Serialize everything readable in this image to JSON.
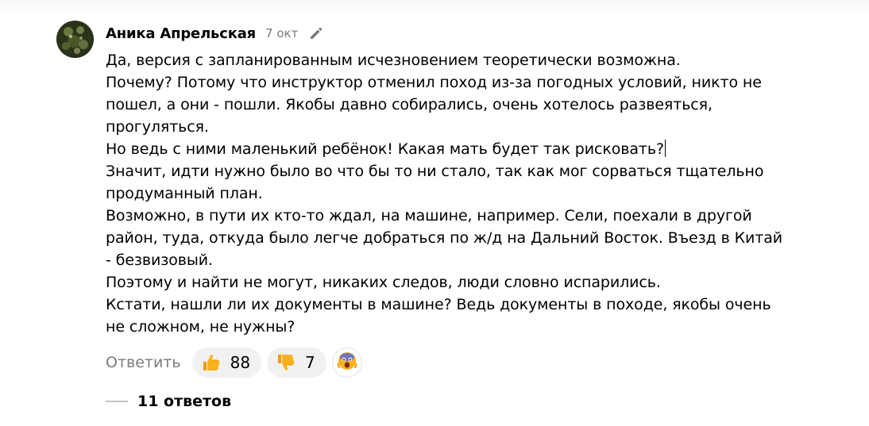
{
  "comment": {
    "author": "Аника Апрельская",
    "date": "7 окт",
    "edit_icon": "pencil-icon",
    "lines": [
      "Да, версия с запланированным исчезновением теоретически возможна.",
      "Почему? Потому что инструктор отменил поход из-за погодных условий, никто не",
      "пошел, а они - пошли. Якобы давно собирались, очень хотелось развеяться,",
      "прогуляться.",
      "Но ведь с ними маленький ребёнок! Какая мать будет так рисковать?",
      "Значит, идти нужно было во что бы то ни стало, так как мог сорваться тщательно",
      "продуманный план.",
      "Возможно, в пути их кто-то ждал, на машине, например. Сели, поехали в другой",
      "район, туда, откуда было легче добраться по ж/д на Дальний Восток. Въезд в Китай",
      "- безвизовый.",
      "Поэтому и найти не могут, никаких следов, люди словно испарились.",
      "Кстати, нашли ли их документы в машине? Ведь документы в походе, якобы очень",
      "не сложном, не нужны?"
    ]
  },
  "actions": {
    "reply_label": "Ответить",
    "like": {
      "icon": "thumbs-up-icon",
      "count": "88"
    },
    "dislike": {
      "icon": "thumbs-down-icon",
      "count": "7"
    },
    "shocked": {
      "icon": "shocked-face-icon"
    }
  },
  "replies": {
    "label": "11 ответов"
  },
  "colors": {
    "muted": "#7a7a7a",
    "pill_bg": "#f1f1f1",
    "emoji_yellow": "#f7b21b"
  }
}
